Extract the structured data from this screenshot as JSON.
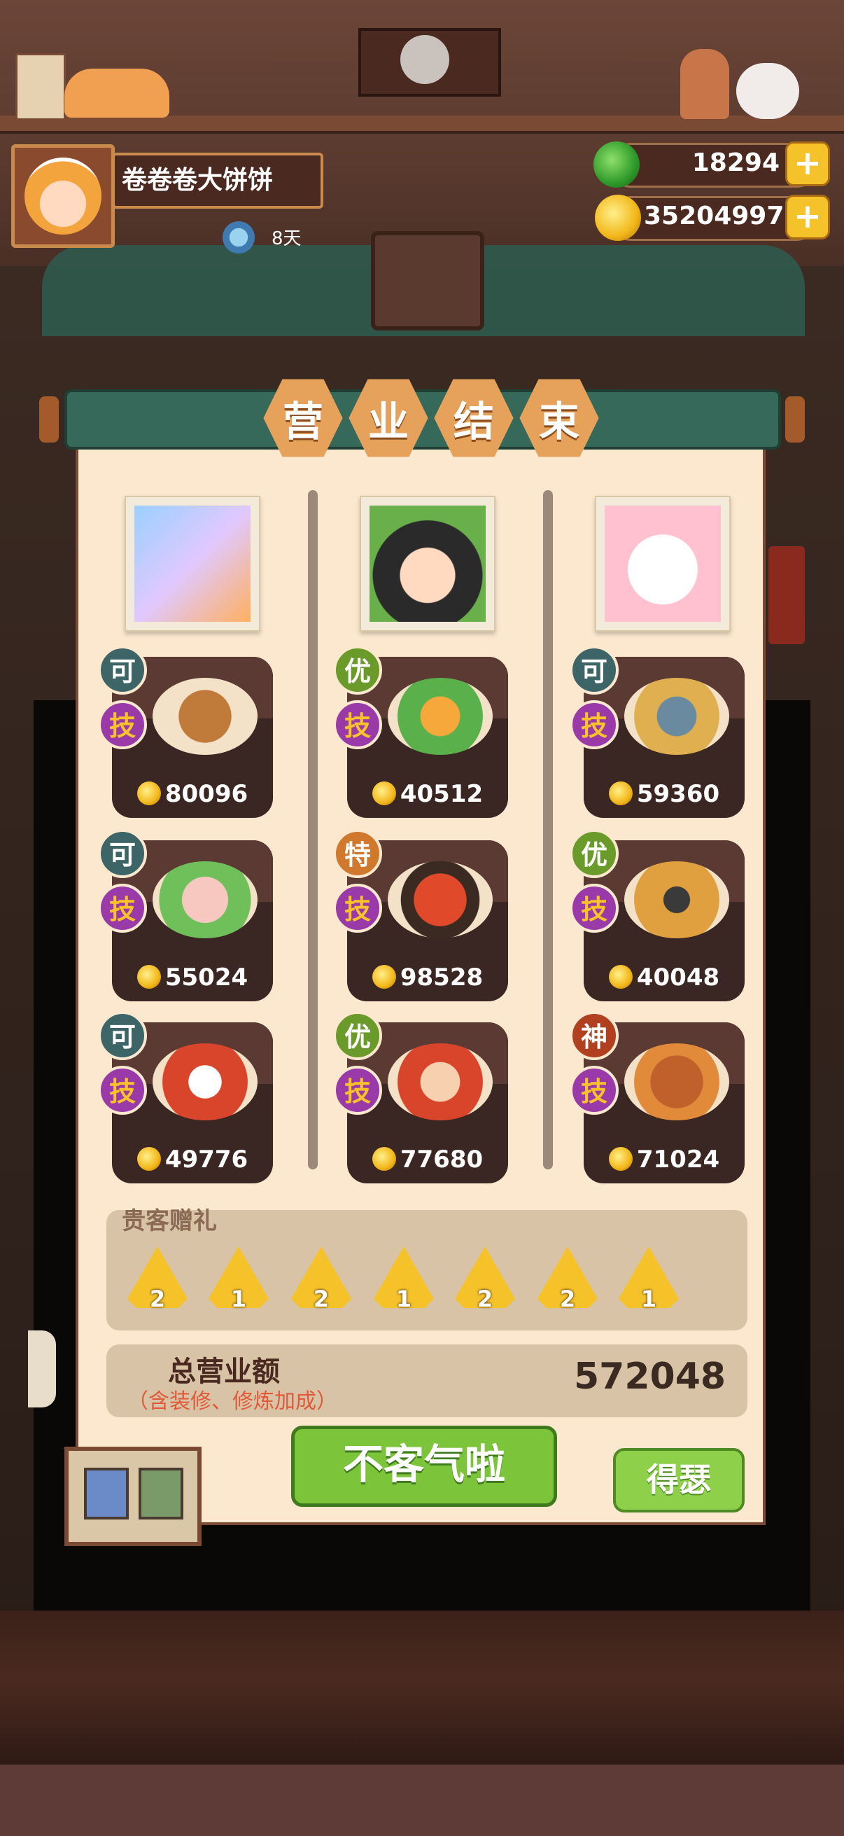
{
  "player": {
    "name": "卷卷卷大饼饼",
    "days": "8天"
  },
  "currency": {
    "gems": "18294",
    "coins": "35204997",
    "plus": "+"
  },
  "title_chars": [
    "营",
    "业",
    "结",
    "束"
  ],
  "columns": [
    {
      "dishes": [
        {
          "rank": "可",
          "skill": "技",
          "price": "80096"
        },
        {
          "rank": "可",
          "skill": "技",
          "price": "55024"
        },
        {
          "rank": "可",
          "skill": "技",
          "price": "49776"
        }
      ]
    },
    {
      "dishes": [
        {
          "rank": "优",
          "skill": "技",
          "price": "40512"
        },
        {
          "rank": "特",
          "skill": "技",
          "price": "98528"
        },
        {
          "rank": "优",
          "skill": "技",
          "price": "77680"
        }
      ]
    },
    {
      "dishes": [
        {
          "rank": "可",
          "skill": "技",
          "price": "59360"
        },
        {
          "rank": "优",
          "skill": "技",
          "price": "40048"
        },
        {
          "rank": "神",
          "skill": "技",
          "price": "71024"
        }
      ]
    }
  ],
  "gifts": {
    "label": "贵客赠礼",
    "counts": [
      "2",
      "1",
      "2",
      "1",
      "2",
      "2",
      "1"
    ]
  },
  "total": {
    "label": "总营业额",
    "note": "（含装修、修炼加成）",
    "value": "572048"
  },
  "buttons": {
    "main": "不客气啦",
    "side": "得瑟"
  },
  "colors": {
    "panel": "#fbe8cf",
    "title_bar": "#36695a",
    "main_button": "#7cc53a"
  }
}
